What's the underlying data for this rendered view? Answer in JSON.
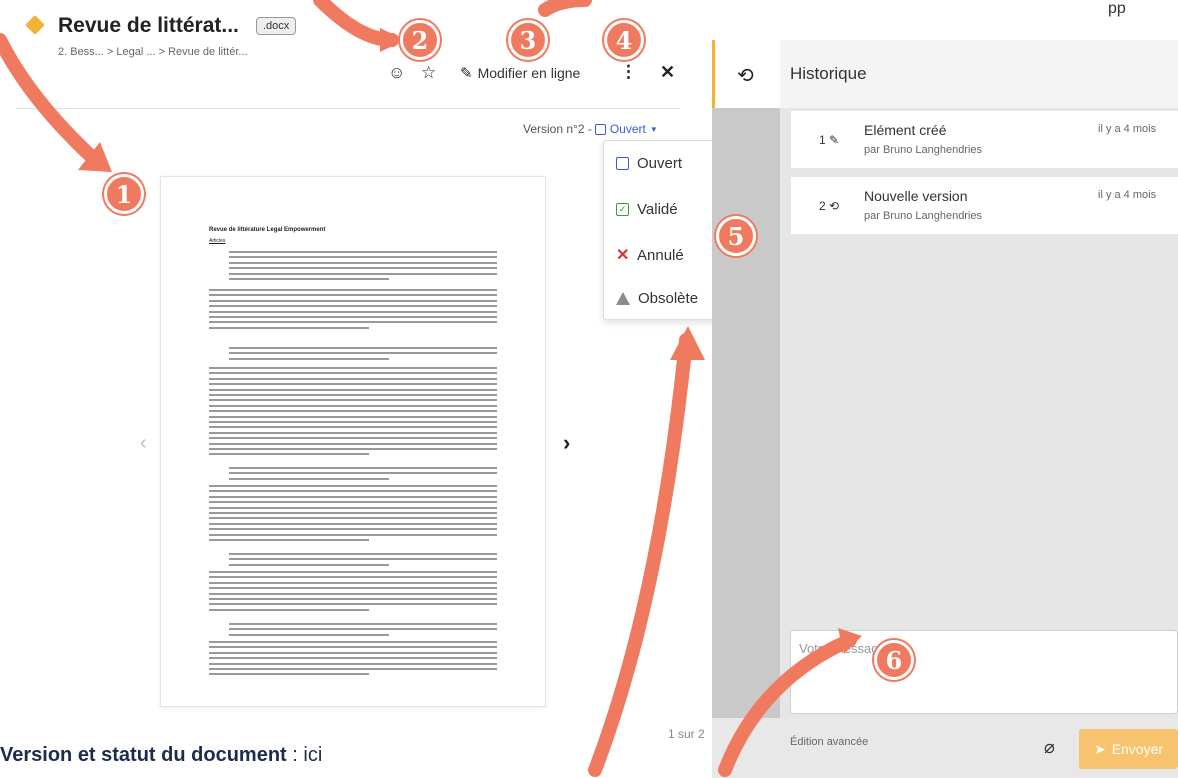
{
  "top_right_text": "pp",
  "document": {
    "title": "Revue de littérat...",
    "extension": ".docx",
    "breadcrumb": "2. Bess... > Legal ... > Revue de littér...",
    "version_label": "Version n°2 -",
    "status_value": "Ouvert",
    "edit_label": "Modifier en ligne",
    "page_count": "1 sur 2"
  },
  "status_menu": {
    "items": [
      {
        "label": "Ouvert",
        "icon": "open-square-icon"
      },
      {
        "label": "Validé",
        "icon": "check-square-icon"
      },
      {
        "label": "Annulé",
        "icon": "cross-icon"
      },
      {
        "label": "Obsolète",
        "icon": "warning-icon"
      }
    ]
  },
  "preview": {
    "heading": "Revue de littérature Legal Empowerment",
    "subheading": "Articles"
  },
  "history": {
    "title": "Historique",
    "entries": [
      {
        "number": "1",
        "icon": "magic-wand-icon",
        "title": "Elément créé",
        "author": "par Bruno Langhendries",
        "time": "il y a 4 mois"
      },
      {
        "number": "2",
        "icon": "history-icon",
        "title": "Nouvelle version",
        "author": "par Bruno Langhendries",
        "time": "il y a 4 mois"
      }
    ]
  },
  "message": {
    "placeholder": "Votre message",
    "advanced_edit": "Édition avancée",
    "send_label": "Envoyer"
  },
  "caption": {
    "bold": "Version et statut du document",
    "rest": " : ici"
  },
  "annotations": [
    "1",
    "2",
    "3",
    "4",
    "5",
    "6"
  ],
  "colors": {
    "accent": "#f2b233",
    "annotation": "#f07a5f",
    "status_blue": "#3a5bd9",
    "send_button": "#f7c36f"
  }
}
